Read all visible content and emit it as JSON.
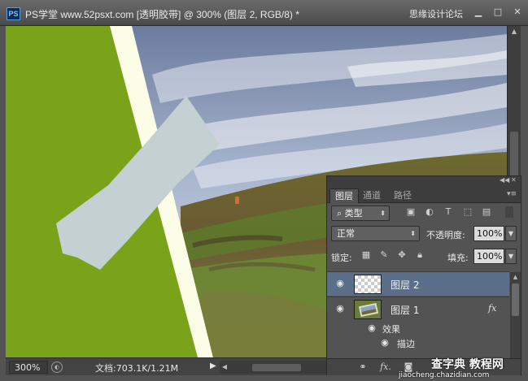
{
  "titlebar": {
    "app_icon": "PS",
    "title": "PS学堂 www.52psxt.com [透明胶带] @ 300% (图层 2, RGB/8) *",
    "watermark": "思缘设计论坛",
    "minimize_icon": "minimize-icon",
    "maximize_icon": "maximize-icon",
    "close_icon": "close-icon"
  },
  "status": {
    "zoom": "300%",
    "doc_info": "文档:703.1K/1.21M"
  },
  "layers_panel": {
    "tabs": [
      "图层",
      "通道",
      "路径"
    ],
    "active_tab": 0,
    "filter": {
      "label": "类型"
    },
    "blend_mode": "正常",
    "opacity_label": "不透明度:",
    "opacity_value": "100%",
    "lock_label": "锁定:",
    "fill_label": "填充:",
    "fill_value": "100%",
    "layers": [
      {
        "name": "图层 2",
        "selected": true,
        "thumbnail": "transparent",
        "fx": ""
      },
      {
        "name": "图层 1",
        "selected": false,
        "thumbnail": "photo",
        "fx": "fx"
      }
    ],
    "effects_label": "效果",
    "effect_items": [
      "描边"
    ],
    "bottom_icons": [
      "link-icon",
      "fx-icon",
      "mask-icon"
    ]
  },
  "watermark": {
    "main": "查字典 教程网",
    "sub": "jiaocheng.chazidian.com"
  },
  "colors": {
    "green_background": "#7aa31a",
    "tape": "#c4d0d1",
    "photo_border": "#fbfde6",
    "selected_layer": "#5b6e8a"
  }
}
